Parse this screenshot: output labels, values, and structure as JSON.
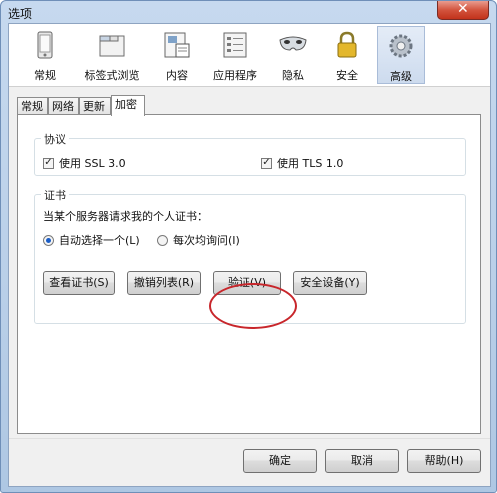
{
  "window": {
    "title": "选项",
    "close_glyph": "✕"
  },
  "toolbar": {
    "items": [
      {
        "label": "常规",
        "icon": "phone-icon"
      },
      {
        "label": "标签式浏览",
        "icon": "tabs-window-icon"
      },
      {
        "label": "内容",
        "icon": "page-content-icon"
      },
      {
        "label": "应用程序",
        "icon": "applications-list-icon"
      },
      {
        "label": "隐私",
        "icon": "privacy-mask-icon"
      },
      {
        "label": "安全",
        "icon": "padlock-icon"
      },
      {
        "label": "高级",
        "icon": "gear-icon",
        "selected": true
      }
    ]
  },
  "tabs": [
    {
      "label": "常规"
    },
    {
      "label": "网络"
    },
    {
      "label": "更新"
    },
    {
      "label": "加密",
      "active": true
    }
  ],
  "protocols": {
    "legend": "协议",
    "ssl": {
      "label": "使用 SSL 3.0",
      "checked": true
    },
    "tls": {
      "label": "使用 TLS 1.0",
      "checked": true
    }
  },
  "certificates": {
    "legend": "证书",
    "prompt": "当某个服务器请求我的个人证书：",
    "options": [
      {
        "label": "自动选择一个(L)",
        "selected": true
      },
      {
        "label": "每次均询问(I)",
        "selected": false
      }
    ],
    "buttons": {
      "view": "查看证书(S)",
      "revocation": "撤销列表(R)",
      "validation": "验证(V)",
      "security_devices": "安全设备(Y)"
    }
  },
  "footer": {
    "ok": "确定",
    "cancel": "取消",
    "help": "帮助(H)"
  },
  "colors": {
    "annotation": "#c8262b",
    "radio_dot": "#1a5dc7"
  }
}
